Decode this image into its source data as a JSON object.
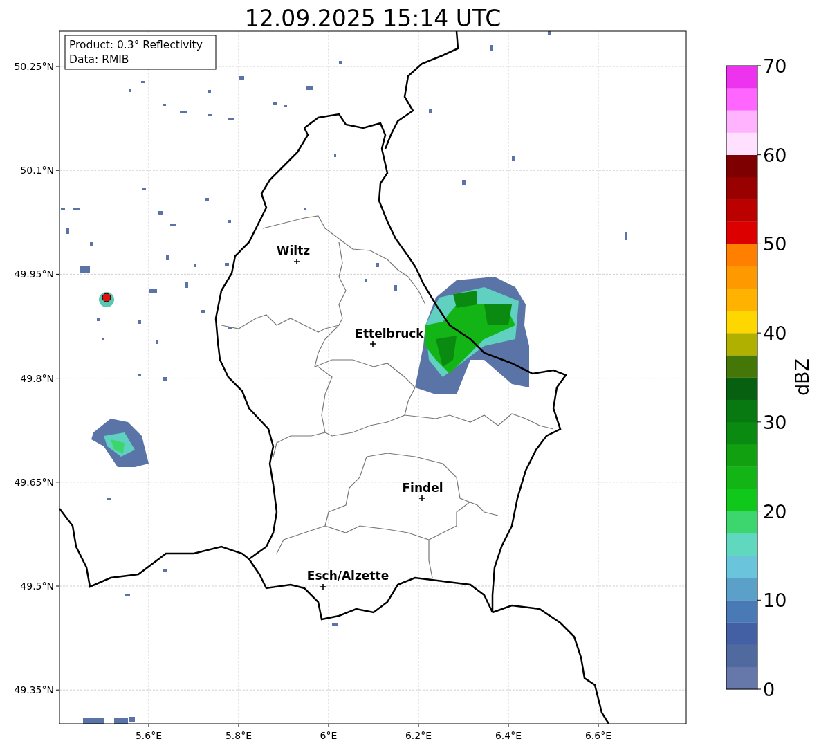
{
  "title": "12.09.2025 15:14 UTC",
  "info_box": [
    "Product: 0.3° Reflectivity",
    "Data: RMIB"
  ],
  "x_ticks": [
    "5.6°E",
    "5.8°E",
    "6°E",
    "6.2°E",
    "6.4°E",
    "6.6°E"
  ],
  "y_ticks": [
    "50.25°N",
    "50.1°N",
    "49.95°N",
    "49.8°N",
    "49.65°N",
    "49.5°N",
    "49.35°N"
  ],
  "cities": [
    "Wiltz",
    "Ettelbruck",
    "Findel",
    "Esch/Alzette"
  ],
  "colorbar": {
    "label": "dBZ",
    "ticks": [
      "70",
      "60",
      "50",
      "40",
      "30",
      "20",
      "10",
      "0"
    ],
    "bands": [
      {
        "color": "#6677aa"
      },
      {
        "color": "#506aa0"
      },
      {
        "color": "#4460a4"
      },
      {
        "color": "#4a7ab5"
      },
      {
        "color": "#5aa0c8"
      },
      {
        "color": "#6ac4dc"
      },
      {
        "color": "#60d8c0"
      },
      {
        "color": "#3dd66e"
      },
      {
        "color": "#10c81a"
      },
      {
        "color": "#12b515"
      },
      {
        "color": "#10a010"
      },
      {
        "color": "#0a8a10"
      },
      {
        "color": "#087810"
      },
      {
        "color": "#066010"
      },
      {
        "color": "#447708"
      },
      {
        "color": "#b0b000"
      },
      {
        "color": "#ffd700"
      },
      {
        "color": "#ffb300"
      },
      {
        "color": "#ff9900"
      },
      {
        "color": "#ff7f00"
      },
      {
        "color": "#dd0000"
      },
      {
        "color": "#bb0000"
      },
      {
        "color": "#990000"
      },
      {
        "color": "#7f0000"
      },
      {
        "color": "#ffe0ff"
      },
      {
        "color": "#ffb3ff"
      },
      {
        "color": "#ff66ff"
      },
      {
        "color": "#ee33ee"
      }
    ]
  }
}
